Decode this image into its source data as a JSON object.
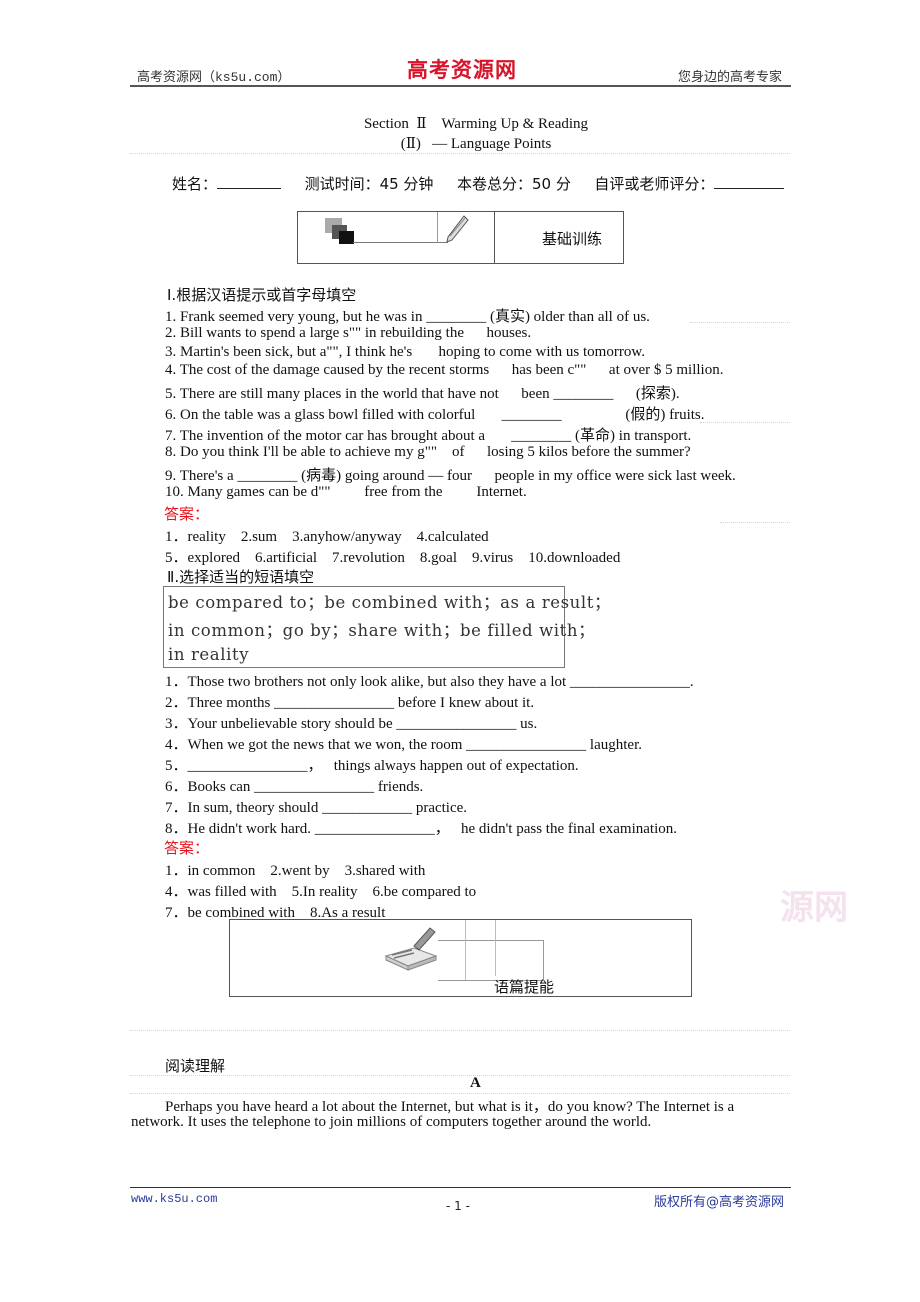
{
  "header": {
    "left": "高考资源网（ks5u.com）",
    "logo": "高考资源网",
    "right": "您身边的高考专家"
  },
  "title": {
    "line1": "Section  Ⅱ    Warming Up & Reading",
    "line2": "(Ⅱ)   — Language Points"
  },
  "info": {
    "name_label": "姓名：",
    "time_label": "测试时间：45 分钟",
    "total_label": "本卷总分：50 分",
    "score_label": "自评或老师评分："
  },
  "banner1": {
    "label": "基础训练"
  },
  "part1": {
    "heading": "Ⅰ.根据汉语提示或首字母填空",
    "items": [
      "1. Frank seemed very young, but he was in ________ (真实) older than all of us.",
      "2. Bill wants to spend a large s\"\" in rebuilding the      houses.",
      "3. Martin's been sick, but a\"\", I think he's       hoping to come with us tomorrow.",
      "4. The cost of the damage caused by the recent storms      has been c\"\"      at over $ 5 million.",
      "5. There are still many places in the world that have not      been ________      (探索).",
      "6. On the table was a glass bowl filled with colorful       ________                 (假的) fruits.",
      "7. The invention of the motor car has brought about a       ________ (革命) in transport.",
      "8. Do you think I'll be able to achieve my g\"\"    of      losing 5 kilos before the summer?",
      "9. There's a ________ (病毒) going around — four      people in my office were sick last week.",
      "10. Many games can be d\"\"         free from the         Internet."
    ],
    "answer_label": "答案：",
    "answers": [
      "1．reality    2.sum    3.anyhow/anyway    4.calculated",
      "5．explored    6.artificial    7.revolution    8.goal    9.virus    10.downloaded"
    ]
  },
  "part2": {
    "heading": "Ⅱ.选择适当的短语填空",
    "phrases": [
      "be compared to；be combined with；as a result；",
      "in common；go by；share with；be filled with；",
      "in reality"
    ],
    "items": [
      "1．Those two brothers not only look alike, but also they have a lot ________________.",
      "2．Three months ________________ before I knew about it.",
      "3．Your unbelievable story should be ________________ us.",
      "4．When we got the news that we won, the room ________________ laughter.",
      "5．________________，   things always happen out of expectation.",
      "6．Books can ________________ friends.",
      "7．In sum, theory should ____________ practice.",
      "8．He didn't work hard. ________________，   he didn't pass the final examination."
    ],
    "answer_label": "答案：",
    "answers": [
      "1．in common    2.went by    3.shared with",
      "4．was filled with    5.In reality    6.be compared to",
      "7．be combined with    8.As a result"
    ]
  },
  "banner2": {
    "label": "语篇提能"
  },
  "reading": {
    "heading": "阅读理解",
    "passage_label": "A",
    "para_line1": "Perhaps you have heard a lot about the Internet, but what is it，do you know? The Internet is a",
    "para_line2": "network. It uses the telephone to join millions of computers together around the world."
  },
  "watermark": "源网",
  "footer": {
    "left": "www.ks5u.com",
    "page": "- 1 -",
    "right": "版权所有@高考资源网"
  }
}
